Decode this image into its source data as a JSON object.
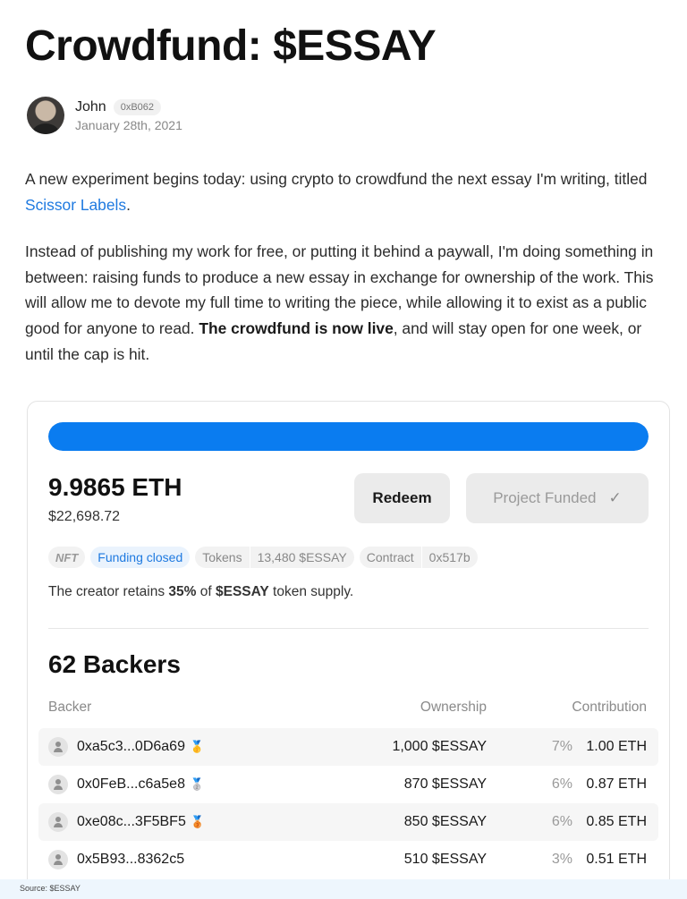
{
  "article": {
    "title": "Crowdfund: $ESSAY",
    "author_name": "John",
    "author_address": "0xB062",
    "date": "January 28th, 2021",
    "p1_text": "A new experiment begins today: using crypto to crowdfund the next essay I'm writing, titled ",
    "p1_link": "Scissor Labels",
    "p1_end": ".",
    "p2_text": "Instead of publishing my work for free, or putting it behind a paywall, I'm doing something in between: raising funds to produce a new essay in exchange for ownership of the work. This will allow me to devote my full time to writing the piece, while allowing it to exist as a public good for anyone to read. ",
    "p2_bold": "The crowdfund is now live",
    "p2_end": ", and will stay open for one week, or until the cap is hit."
  },
  "crowdfund": {
    "progress_fraction": 1.0,
    "progress_color": "#0a7cf0",
    "eth_raised": "9.9865 ETH",
    "usd_raised": "$22,698.72",
    "redeem_label": "Redeem",
    "funded_label": "Project Funded",
    "funded_icon": "check-icon",
    "tags": {
      "nft": "NFT",
      "status": "Funding closed",
      "tokens_label": "Tokens",
      "tokens_value": "13,480 $ESSAY",
      "contract_label": "Contract",
      "contract_value": "0x517b"
    },
    "retains_prefix": "The creator retains ",
    "retains_pct": "35%",
    "retains_mid": " of ",
    "retains_token": "$ESSAY",
    "retains_suffix": " token supply."
  },
  "backers": {
    "title": "62 Backers",
    "columns": {
      "backer": "Backer",
      "ownership": "Ownership",
      "contribution": "Contribution"
    },
    "rows": [
      {
        "address": "0xa5c3...0D6a69",
        "medal": "🥇",
        "ownership": "1,000 $ESSAY",
        "percent": "7%",
        "contribution": "1.00 ETH"
      },
      {
        "address": "0x0FeB...c6a5e8",
        "medal": "🥈",
        "ownership": "870 $ESSAY",
        "percent": "6%",
        "contribution": "0.87 ETH"
      },
      {
        "address": "0xe08c...3F5BF5",
        "medal": "🥉",
        "ownership": "850 $ESSAY",
        "percent": "6%",
        "contribution": "0.85 ETH"
      },
      {
        "address": "0x5B93...8362c5",
        "medal": "",
        "ownership": "510 $ESSAY",
        "percent": "3%",
        "contribution": "0.51 ETH"
      }
    ]
  },
  "footer": {
    "source": "Source: $ESSAY"
  }
}
